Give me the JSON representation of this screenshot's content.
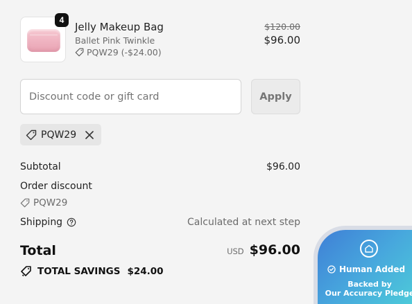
{
  "product": {
    "quantity": "4",
    "name": "Jelly Makeup Bag",
    "variant": "Ballet Pink Twinkle",
    "discount_line": "PQW29 (-$24.00)",
    "original_price": "$120.00",
    "price": "$96.00"
  },
  "discount": {
    "placeholder": "Discount code or gift card",
    "value": "",
    "apply_label": "Apply",
    "applied_code": "PQW29"
  },
  "summary": {
    "subtotal_label": "Subtotal",
    "subtotal_value": "$96.00",
    "order_discount_label": "Order discount",
    "order_discount_code": "PQW29",
    "shipping_label": "Shipping",
    "shipping_value": "Calculated at next step",
    "total_label": "Total",
    "currency": "USD",
    "total_value": "$96.00",
    "savings_label": "TOTAL SAVINGS",
    "savings_value": "$24.00"
  },
  "trust_badge": {
    "title": "Human Added",
    "line1": "Backed by",
    "line2": "Our Accuracy Pledge"
  },
  "colors": {
    "background": "#f4f4f4",
    "badge_gradient_start": "#3f7fd6",
    "badge_gradient_end": "#4fd4d8"
  },
  "icons": [
    "tag-icon",
    "close-icon",
    "help-circle-icon",
    "double-tag-icon",
    "home-shield-icon",
    "check-circle-icon"
  ]
}
